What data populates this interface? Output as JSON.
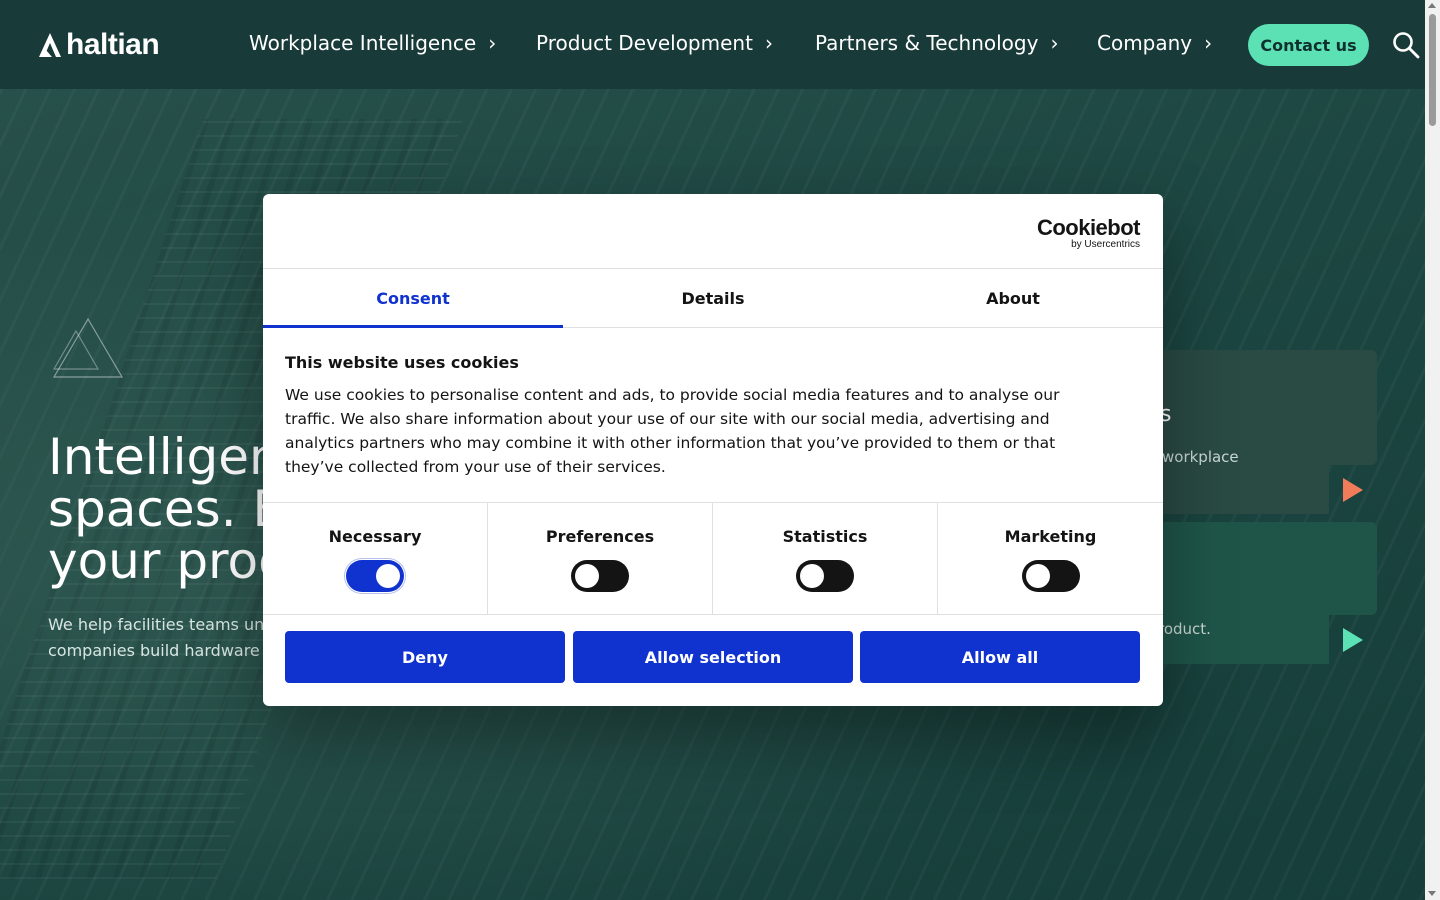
{
  "brand": {
    "name": "haltian",
    "accent": "#5ce1b5",
    "header_bg": "#183a39"
  },
  "nav": {
    "items": [
      {
        "label": "Workplace Intelligence"
      },
      {
        "label": "Product Development"
      },
      {
        "label": "Partners & Technology"
      },
      {
        "label": "Company"
      }
    ],
    "chevron": "›",
    "contact_label": "Contact us",
    "search_icon": "search-icon"
  },
  "hero": {
    "title": "Intelligen\nspaces. E\nyour proc",
    "subtitle": "We help facilities teams un\ncompanies build hardware",
    "card1_letter": "s",
    "card1_text": "workplace",
    "card2_text": "roduct."
  },
  "cookie_dialog": {
    "logo": {
      "wordmark": "Cookiebot",
      "by": "by Usercentrics"
    },
    "tabs": [
      {
        "label": "Consent",
        "active": true
      },
      {
        "label": "Details",
        "active": false
      },
      {
        "label": "About",
        "active": false
      }
    ],
    "heading": "This website uses cookies",
    "body": "We use cookies to personalise content and ads, to provide social media features and to analyse our traffic. We also share information about your use of our site with our social media, advertising and analytics partners who may combine it with other information that you’ve provided to them or that they’ve collected from your use of their services.",
    "categories": [
      {
        "label": "Necessary",
        "enabled": true
      },
      {
        "label": "Preferences",
        "enabled": false
      },
      {
        "label": "Statistics",
        "enabled": false
      },
      {
        "label": "Marketing",
        "enabled": false
      }
    ],
    "buttons": {
      "deny": "Deny",
      "allow_selection": "Allow selection",
      "allow_all": "Allow all"
    },
    "primary_color": "#1032cf"
  }
}
